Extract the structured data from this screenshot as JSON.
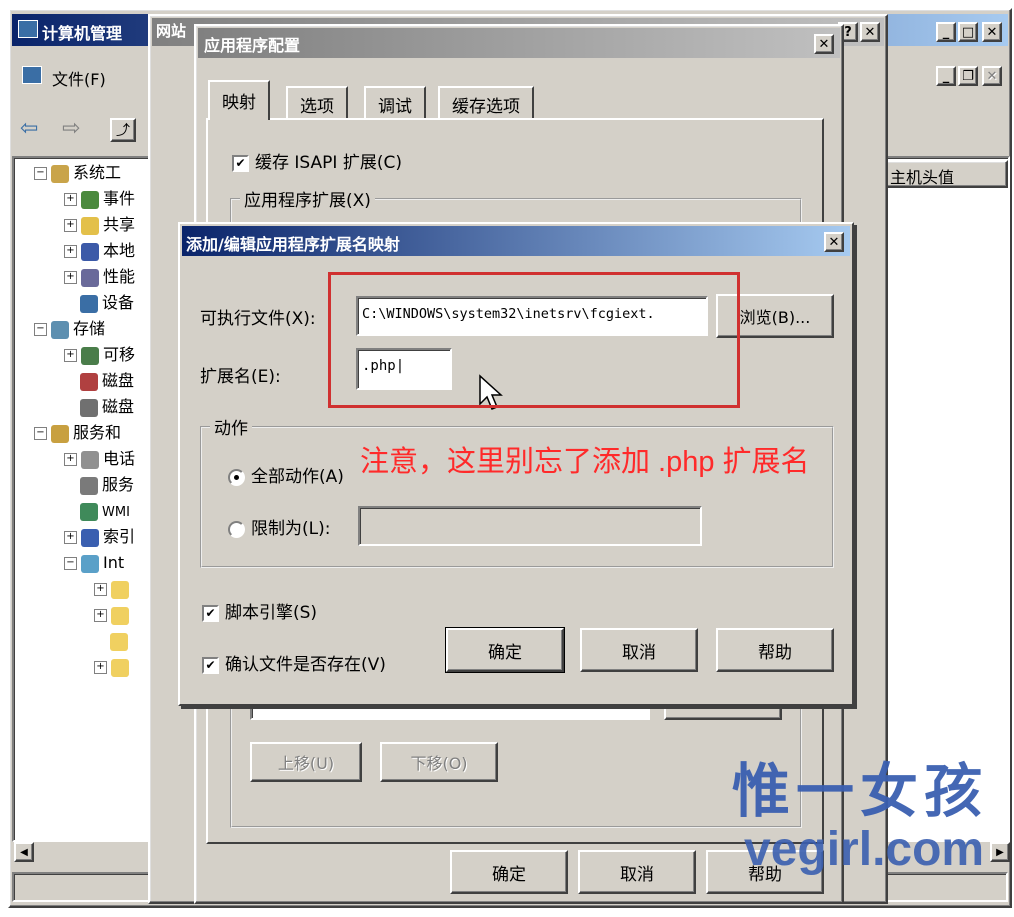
{
  "mmc": {
    "title": "计算机管理",
    "menu_file": "文件(F)",
    "tree": [
      {
        "label": "系统工"
      },
      {
        "label": "事件"
      },
      {
        "label": "共享"
      },
      {
        "label": "本地"
      },
      {
        "label": "性能"
      },
      {
        "label": "设备"
      },
      {
        "label": "存储"
      },
      {
        "label": "可移"
      },
      {
        "label": "磁盘"
      },
      {
        "label": "磁盘"
      },
      {
        "label": "服务和"
      },
      {
        "label": "电话"
      },
      {
        "label": "服务"
      },
      {
        "label": "WMI"
      },
      {
        "label": "索引"
      },
      {
        "label": "Int"
      }
    ],
    "column_header": "主机头值"
  },
  "site_dialog": {
    "title": "网站"
  },
  "app_config": {
    "title": "应用程序配置",
    "tabs": [
      "映射",
      "选项",
      "调试",
      "缓存选项"
    ],
    "cache_isapi_label": "缓存 ISAPI 扩展(C)",
    "cache_isapi_checked": true,
    "extensions_group": "应用程序扩展(X)",
    "move_up": "上移(U)",
    "move_down": "下移(O)",
    "ok": "确定",
    "cancel": "取消",
    "help": "帮助"
  },
  "edit_dialog": {
    "title": "添加/编辑应用程序扩展名映射",
    "executable_label": "可执行文件(X):",
    "executable_value": "C:\\WINDOWS\\system32\\inetsrv\\fcgiext.",
    "browse_label": "浏览(B)...",
    "extension_label": "扩展名(E):",
    "extension_value": ".php",
    "verbs_group": "动作",
    "all_verbs_label": "全部动作(A)",
    "limit_to_label": "限制为(L):",
    "limit_to_value": "",
    "script_engine_label": "脚本引擎(S)",
    "script_engine_checked": true,
    "verify_file_label": "确认文件是否存在(V)",
    "verify_file_checked": true,
    "ok": "确定",
    "cancel": "取消",
    "help": "帮助"
  },
  "annotation": {
    "text": "注意，这里别忘了添加 .php 扩展名",
    "color": "#ff2a2a",
    "box_color": "#d03030"
  },
  "watermark": {
    "cn": "惟一女孩",
    "url": "vegirl.com",
    "color": "#3a5fb0"
  },
  "colors": {
    "face": "#d4d0c8",
    "title_active": "#0a246a",
    "title_inactive": "#808080"
  }
}
